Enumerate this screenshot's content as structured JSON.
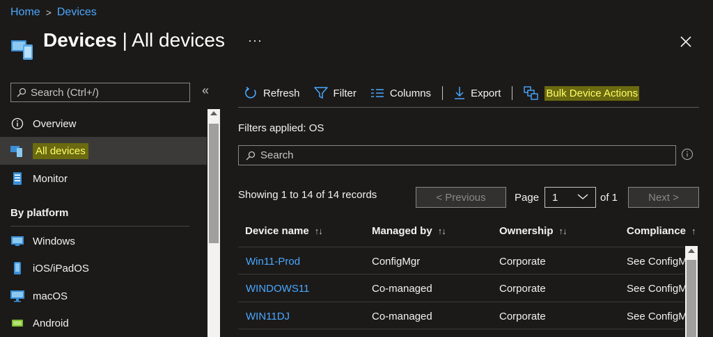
{
  "breadcrumb": {
    "home": "Home",
    "separator": ">",
    "current": "Devices"
  },
  "header": {
    "title_bold": "Devices",
    "title_rest": " | All devices",
    "more": "···"
  },
  "sidebar": {
    "search_placeholder": "Search (Ctrl+/)",
    "collapse": "«",
    "items": [
      {
        "label": "Overview",
        "icon": "info-icon"
      },
      {
        "label": "All devices",
        "icon": "devices-icon",
        "active": true
      },
      {
        "label": "Monitor",
        "icon": "monitor-icon"
      }
    ],
    "group_label": "By platform",
    "platforms": [
      {
        "label": "Windows",
        "icon": "windows-icon"
      },
      {
        "label": "iOS/iPadOS",
        "icon": "ios-icon"
      },
      {
        "label": "macOS",
        "icon": "macos-icon"
      },
      {
        "label": "Android",
        "icon": "android-icon"
      }
    ]
  },
  "toolbar": {
    "refresh": "Refresh",
    "filter": "Filter",
    "columns": "Columns",
    "export": "Export",
    "bulk": "Bulk Device Actions"
  },
  "main": {
    "filters_applied": "Filters applied: OS",
    "search_placeholder": "Search",
    "showing": "Showing 1 to 14 of 14 records",
    "pager": {
      "previous": "< Previous",
      "page_label": "Page",
      "page_value": "1",
      "of_label": "of 1",
      "next": "Next >"
    }
  },
  "table": {
    "columns": [
      "Device name",
      "Managed by",
      "Ownership",
      "Compliance"
    ],
    "rows": [
      [
        "Win11-Prod",
        "ConfigMgr",
        "Corporate",
        "See ConfigMgr"
      ],
      [
        "WINDOWS11",
        "Co-managed",
        "Corporate",
        "See ConfigMgr"
      ],
      [
        "WIN11DJ",
        "Co-managed",
        "Corporate",
        "See ConfigMgr"
      ]
    ]
  },
  "colors": {
    "accent": "#4aa8ff",
    "highlight": "#ffff66",
    "background": "#1b1a19"
  }
}
